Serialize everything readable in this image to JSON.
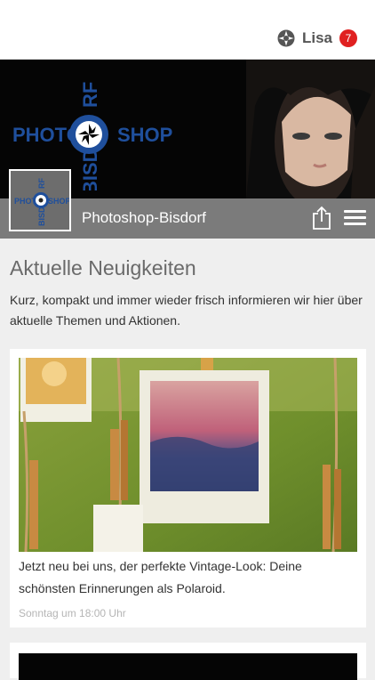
{
  "topbar": {
    "user_name": "Lisa",
    "notification_count": "7"
  },
  "header": {
    "page_title": "Photoshop-Bisdorf",
    "logo": {
      "word_left": "PHOTO",
      "word_right": "SHOP",
      "vertical_top": "RF",
      "vertical_bottom": "BISD"
    }
  },
  "section": {
    "title": "Aktuelle Neuigkeiten",
    "description": "Kurz, kompakt und immer wieder frisch informieren wir hier über aktuelle Themen und Aktionen."
  },
  "news": [
    {
      "text": "Jetzt neu bei uns, der perfekte Vintage-Look: Deine schönsten Erinnerungen als Polaroid.",
      "date": "Sonntag um 18:00 Uhr"
    }
  ],
  "colors": {
    "accent_blue": "#1f4f9c",
    "badge_red": "#e02020",
    "title_bar": "#7b7b7b"
  },
  "icons": [
    "user-settings-icon",
    "share-icon",
    "hamburger-menu-icon"
  ]
}
